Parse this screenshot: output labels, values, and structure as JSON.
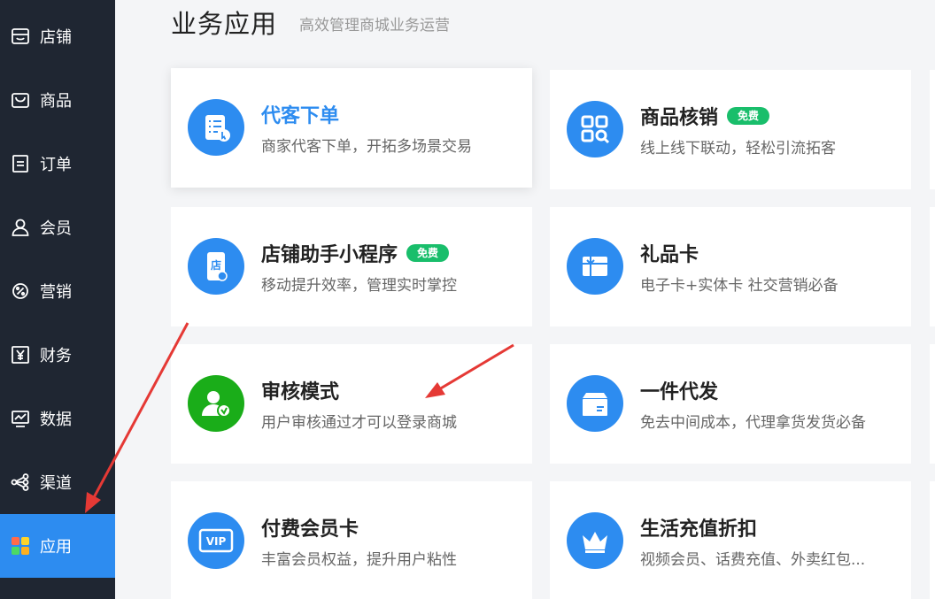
{
  "sidebar": {
    "items": [
      {
        "label": "店铺",
        "icon": "store-icon",
        "active": false
      },
      {
        "label": "商品",
        "icon": "shopping-bag-icon",
        "active": false
      },
      {
        "label": "订单",
        "icon": "order-doc-icon",
        "active": false
      },
      {
        "label": "会员",
        "icon": "user-icon",
        "active": false
      },
      {
        "label": "营销",
        "icon": "discount-gear-icon",
        "active": false
      },
      {
        "label": "财务",
        "icon": "yen-icon",
        "active": false
      },
      {
        "label": "数据",
        "icon": "chart-monitor-icon",
        "active": false
      },
      {
        "label": "渠道",
        "icon": "share-nodes-icon",
        "active": false
      },
      {
        "label": "应用",
        "icon": "apps-grid-icon",
        "active": true
      }
    ]
  },
  "header": {
    "title": "业务应用",
    "subtitle": "高效管理商城业务运营"
  },
  "apps": [
    {
      "title": "代客下单",
      "desc": "商家代客下单，开拓多场景交易",
      "icon": "order-list-icon",
      "badge": null,
      "highlight": true
    },
    {
      "title": "商品核销",
      "desc": "线上线下联动，轻松引流拓客",
      "icon": "qr-scan-icon",
      "badge": "免费",
      "highlight": false
    },
    {
      "title": "店铺助手小程序",
      "desc": "移动提升效率，管理实时掌控",
      "icon": "mobile-shop-icon",
      "badge": "免费",
      "highlight": false
    },
    {
      "title": "礼品卡",
      "desc": "电子卡+实体卡 社交营销必备",
      "icon": "gift-card-icon",
      "badge": null,
      "highlight": false
    },
    {
      "title": "审核模式",
      "desc": "用户审核通过才可以登录商城",
      "icon": "user-verify-icon",
      "badge": null,
      "highlight": false
    },
    {
      "title": "一件代发",
      "desc": "免去中间成本，代理拿货发货必备",
      "icon": "package-box-icon",
      "badge": null,
      "highlight": false
    },
    {
      "title": "付费会员卡",
      "desc": "丰富会员权益，提升用户粘性",
      "icon": "vip-card-icon",
      "badge": null,
      "highlight": false
    },
    {
      "title": "生活充值折扣",
      "desc": "视频会员、话费充值、外卖红包...",
      "icon": "crown-icon",
      "badge": null,
      "highlight": false
    }
  ],
  "colors": {
    "sidebar_bg": "#1f2632",
    "active_blue": "#2d8cf0",
    "icon_blue": "#2d8cf0",
    "icon_green": "#1aad19",
    "badge_green": "#19be6b",
    "annotation_red": "#e53935"
  }
}
